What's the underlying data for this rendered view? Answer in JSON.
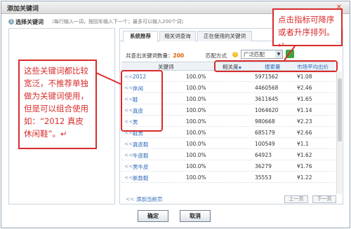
{
  "window": {
    "title": "添加关键词",
    "close_glyph": "✕"
  },
  "step": {
    "icon": "1",
    "label": "选择关键词",
    "hint": "（每行输入一词，按回车输入下一个；最多可以输入200个词）"
  },
  "tabs": [
    {
      "label": "系统推荐",
      "active": true
    },
    {
      "label": "相关词查询",
      "active": false
    },
    {
      "label": "正在使用的关键词",
      "active": false
    }
  ],
  "stats": {
    "prefix": "共查出关键词数量：",
    "count": "200"
  },
  "match": {
    "label": "匹配方式",
    "help_icon": "?",
    "selected": "广泛匹配",
    "arrow": "▼",
    "ok_badge": "✓"
  },
  "table": {
    "headers": {
      "keyword": "关键词",
      "relevance": "相关度",
      "sort_arrow": "◆",
      "search_volume": "搜索量",
      "avg_price": "市场平均出价"
    },
    "add_glyph": "<<",
    "rows": [
      {
        "keyword": "2012",
        "relevance": "100.0%",
        "volume": "5971562",
        "price": "¥1.08"
      },
      {
        "keyword": "休闲",
        "relevance": "100.0%",
        "volume": "4460568",
        "price": "¥2.46"
      },
      {
        "keyword": "鞋",
        "relevance": "100.0%",
        "volume": "3611645",
        "price": "¥1.65"
      },
      {
        "keyword": "真皮",
        "relevance": "100.0%",
        "volume": "1064620",
        "price": "¥1.14"
      },
      {
        "keyword": "男",
        "relevance": "100.0%",
        "volume": "980668",
        "price": "¥2.23"
      },
      {
        "keyword": "鞋男",
        "relevance": "100.0%",
        "volume": "685179",
        "price": "¥2.66"
      },
      {
        "keyword": "真皮鞋",
        "relevance": "100.0%",
        "volume": "100549",
        "price": "¥1.1"
      },
      {
        "keyword": "牛皮鞋",
        "relevance": "100.0%",
        "volume": "64923",
        "price": "¥1.62"
      },
      {
        "keyword": "男牛皮",
        "relevance": "100.0%",
        "volume": "36279",
        "price": "¥1.76"
      },
      {
        "keyword": "新款鞋",
        "relevance": "100.0%",
        "volume": "35553",
        "price": "¥1.22"
      }
    ]
  },
  "footer": {
    "add_page": "添加当前页",
    "prev": "上一页",
    "next": "下一页"
  },
  "buttons": {
    "ok": "确定",
    "cancel": "取消"
  },
  "annotations": {
    "left": "这些关键词都比较宽泛，不推荐单独做为关键词使用，但是可以组合使用如：“2012 真皮休闲鞋”。↵",
    "right": "点击指标可降序或者升序排列。↵"
  },
  "colors": {
    "annotation": "#d92b2b",
    "link": "#2a66b8",
    "count": "#e06000"
  }
}
